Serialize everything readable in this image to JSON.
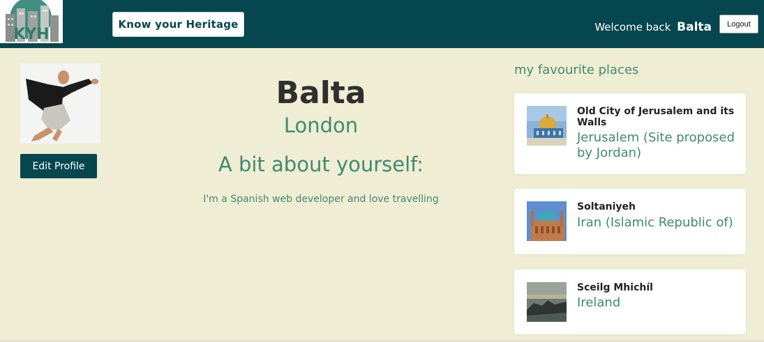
{
  "header": {
    "logo_text": "KYH",
    "brand_label": "Know your Heritage",
    "welcome_prefix": "Welcome back",
    "welcome_name": "Balta",
    "logout_label": "Logout"
  },
  "profile": {
    "edit_label": "Edit Profile",
    "name": "Balta",
    "city": "London",
    "about_heading": "A bit about yourself:",
    "about_text": "I'm a Spanish web developer and love travelling"
  },
  "favourites": {
    "title": "my favourite places",
    "items": [
      {
        "name": "Old City of Jerusalem and its Walls",
        "country": "Jerusalem (Site proposed by Jordan)"
      },
      {
        "name": "Soltaniyeh",
        "country": "Iran (Islamic Republic of)"
      },
      {
        "name": "Sceilg Mhichíl",
        "country": "Ireland"
      }
    ]
  },
  "colors": {
    "header_bg": "#05464f",
    "page_bg": "#efedd3",
    "accent": "#3f8a72"
  }
}
